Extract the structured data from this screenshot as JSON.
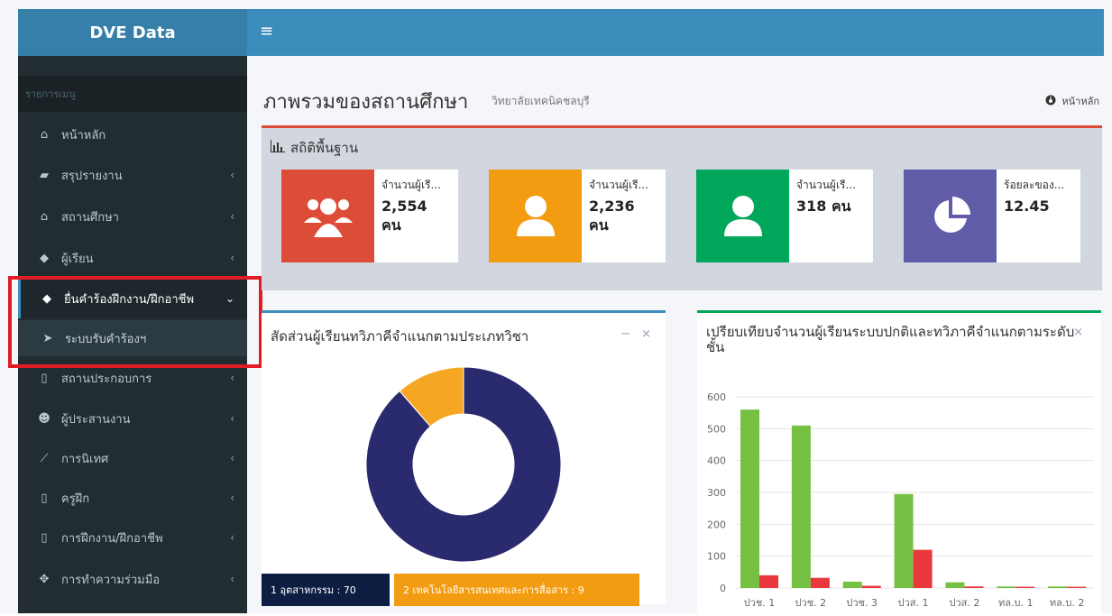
{
  "app": {
    "brand": "DVE Data",
    "hamburger_icon": "≡"
  },
  "sidebar": {
    "header": "รายการเมนู",
    "items": [
      {
        "label": "หน้าหลัก",
        "icon": "home-icon",
        "has_chevron": false
      },
      {
        "label": "สรุปรายงาน",
        "icon": "book-icon",
        "has_chevron": true
      },
      {
        "label": "สถานศึกษา",
        "icon": "institution-icon",
        "has_chevron": true
      },
      {
        "label": "ผู้เรียน",
        "icon": "graduation-cap-icon",
        "has_chevron": true
      },
      {
        "label": "ยื่นคำร้องฝึกงาน/ฝึกอาชีพ",
        "icon": "graduation-cap-icon",
        "has_chevron": true,
        "active": true
      },
      {
        "label": "ระบบรับคำร้องฯ",
        "icon": "paper-plane-icon",
        "sub": true
      },
      {
        "label": "สถานประกอบการ",
        "icon": "building-icon",
        "has_chevron": true
      },
      {
        "label": "ผู้ประสานงาน",
        "icon": "users-icon",
        "has_chevron": true
      },
      {
        "label": "การนิเทศ",
        "icon": "line-chart-icon",
        "has_chevron": true
      },
      {
        "label": "ครูฝึก",
        "icon": "building-icon",
        "has_chevron": true
      },
      {
        "label": "การฝึกงาน/ฝึกอาชีพ",
        "icon": "building-icon",
        "has_chevron": true
      },
      {
        "label": "การทำความร่วมมือ",
        "icon": "handshake-icon",
        "has_chevron": true
      }
    ]
  },
  "header": {
    "title": "ภาพรวมของสถานศึกษา",
    "subtitle": "วิทยาลัยเทคนิคชลบุรี",
    "breadcrumb": "หน้าหลัก"
  },
  "stats": {
    "title": "สถิติพื้นฐาน",
    "boxes": [
      {
        "label": "จำนวนผู้เรี...",
        "value": "2,554",
        "unit": "คน",
        "color": "#dd4b39",
        "icon": "users-icon"
      },
      {
        "label": "จำนวนผู้เรี...",
        "value": "2,236",
        "unit": "คน",
        "color": "#f39c12",
        "icon": "user-icon"
      },
      {
        "label": "จำนวนผู้เรี...",
        "value": "318 คน",
        "unit": "",
        "color": "#00a65a",
        "icon": "user-icon"
      },
      {
        "label": "ร้อยละของ...",
        "value": "12.45",
        "unit": "",
        "color": "#605ca8",
        "icon": "pie-chart-icon"
      }
    ]
  },
  "donut": {
    "title": "สัดส่วนผู้เรียนทวิภาคีจำแนกตามประเภทวิชา",
    "tools": [
      "−",
      "×"
    ],
    "legend": [
      {
        "label": "1 อุตสาหกรรม : 70",
        "color": "#0d1e42"
      },
      {
        "label": "2 เทคโนโลยีสารสนเทศและการสื่อสาร : 9",
        "color": "#f39c12"
      }
    ]
  },
  "bars": {
    "title": "เปรียบเทียบจำนวนผู้เรียนระบบปกติและทวิภาคีจำแนกตามระดับชั้น",
    "close": "×"
  },
  "chart_data": [
    {
      "type": "pie",
      "labels": [
        "อุตสาหกรรม",
        "เทคโนโลยีสารสนเทศและการสื่อสาร"
      ],
      "values": [
        70,
        9
      ],
      "colors": [
        "#2a2a6e",
        "#f5a623"
      ]
    },
    {
      "type": "bar",
      "categories": [
        "ปวช. 1",
        "ปวช. 2",
        "ปวช. 3",
        "ปวส. 1",
        "ปวส. 2",
        "ทล.บ. 1",
        "ทล.บ. 2"
      ],
      "series": [
        {
          "values": [
            560,
            510,
            20,
            295,
            18,
            5,
            5
          ],
          "color": "#76c043"
        },
        {
          "values": [
            40,
            32,
            7,
            120,
            5,
            4,
            4
          ],
          "color": "#e8383d"
        }
      ],
      "ylim": [
        0,
        600
      ],
      "yticks": [
        0,
        100,
        200,
        300,
        400,
        500,
        600
      ],
      "grid": true
    }
  ]
}
